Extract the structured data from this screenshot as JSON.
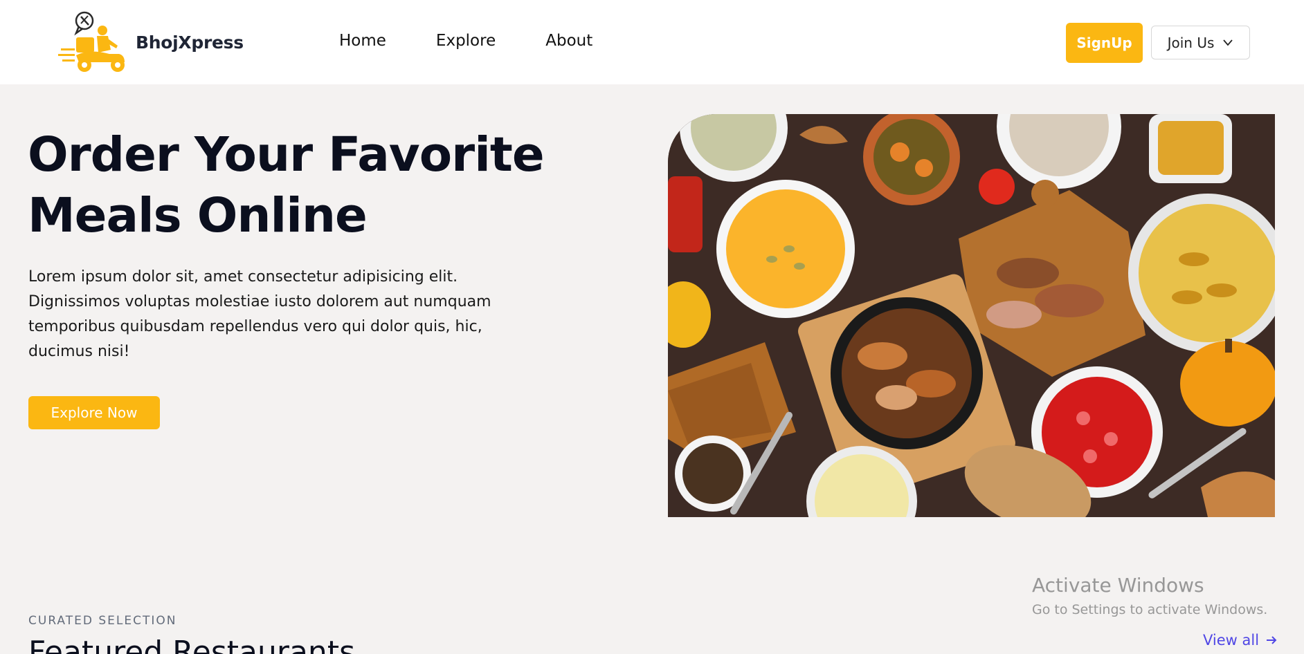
{
  "header": {
    "brand": "BhojXpress",
    "nav": [
      "Home",
      "Explore",
      "About"
    ],
    "signup_label": "SignUp",
    "join_label": "Join Us",
    "accent_color": "#fbb712"
  },
  "hero": {
    "title_line1": "Order Your Favorite",
    "title_line2": "Meals Online",
    "description": "Lorem ipsum dolor sit, amet consectetur adipisicing elit. Dignissimos voluptas molestiae iusto dolorem aut numquam temporibus quibusdam repellendus vero qui dolor quis, hic, ducimus nisi!",
    "cta_label": "Explore Now"
  },
  "section": {
    "eyebrow": "CURATED SELECTION",
    "title": "Featured Restaurants",
    "view_all_label": "View all",
    "link_color": "#4f46e5"
  },
  "watermark": {
    "title": "Activate Windows",
    "subtitle": "Go to Settings to activate Windows."
  },
  "icons": {
    "logo": "delivery-scooter-icon",
    "join_dropdown": "chevron-down-icon",
    "view_all": "arrow-right-icon"
  }
}
